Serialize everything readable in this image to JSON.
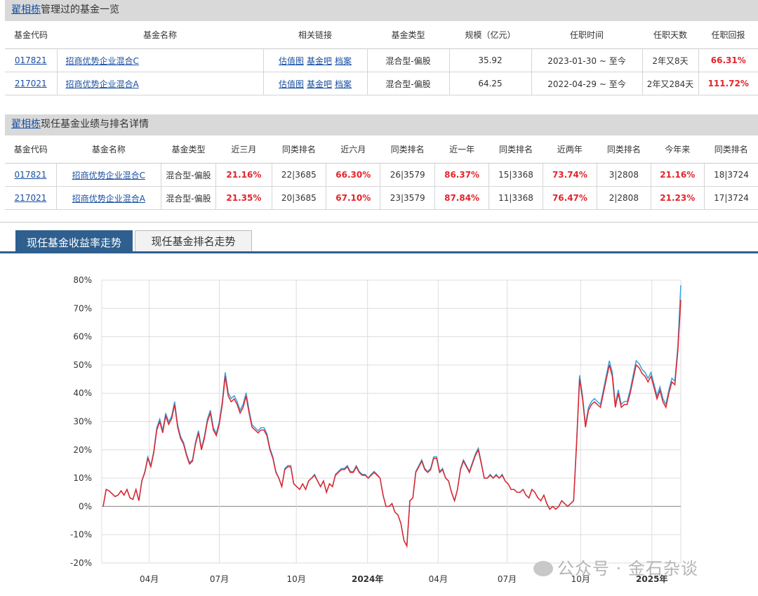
{
  "managed": {
    "manager": "翟相栋",
    "title_suffix": "管理过的基金一览",
    "headers": [
      "基金代码",
      "基金名称",
      "相关链接",
      "基金类型",
      "规模（亿元）",
      "任职时间",
      "任职天数",
      "任职回报"
    ],
    "link_labels": [
      "估值图",
      "基金吧",
      "档案"
    ],
    "rows": [
      {
        "code": "017821",
        "name": "招商优势企业混合C",
        "type": "混合型-偏股",
        "size": "35.92",
        "period": "2023-01-30 ~ 至今",
        "days": "2年又8天",
        "return": "66.31%"
      },
      {
        "code": "217021",
        "name": "招商优势企业混合A",
        "type": "混合型-偏股",
        "size": "64.25",
        "period": "2022-04-29 ~ 至今",
        "days": "2年又284天",
        "return": "111.72%"
      }
    ]
  },
  "current": {
    "manager": "翟相栋",
    "title_suffix": "现任基金业绩与排名详情",
    "headers": [
      "基金代码",
      "基金名称",
      "基金类型",
      "近三月",
      "同类排名",
      "近六月",
      "同类排名",
      "近一年",
      "同类排名",
      "近两年",
      "同类排名",
      "今年来",
      "同类排名"
    ],
    "rows": [
      {
        "code": "017821",
        "name": "招商优势企业混合C",
        "type": "混合型-偏股",
        "m3": "21.16%",
        "r3": "22|3685",
        "m6": "66.30%",
        "r6": "26|3579",
        "y1": "86.37%",
        "ry1": "15|3368",
        "y2": "73.74%",
        "ry2": "3|2808",
        "ytd": "21.16%",
        "rytd": "18|3724"
      },
      {
        "code": "217021",
        "name": "招商优势企业混合A",
        "type": "混合型-偏股",
        "m3": "21.35%",
        "r3": "20|3685",
        "m6": "67.10%",
        "r6": "23|3579",
        "y1": "87.84%",
        "ry1": "11|3368",
        "y2": "76.47%",
        "ry2": "2|2808",
        "ytd": "21.23%",
        "rytd": "17|3724"
      }
    ]
  },
  "tabs": [
    "现任基金收益率走势",
    "现任基金排名走势"
  ],
  "watermark": "公众号 · 金石杂谈",
  "chart_data": {
    "type": "line",
    "ylim": [
      -20,
      80
    ],
    "yticks": [
      "80%",
      "70%",
      "60%",
      "50%",
      "40%",
      "30%",
      "20%",
      "10%",
      "0%",
      "-10%",
      "-20%"
    ],
    "xticks": [
      {
        "label": "04月",
        "bold": false,
        "pos": 0.082
      },
      {
        "label": "07月",
        "bold": false,
        "pos": 0.203
      },
      {
        "label": "10月",
        "bold": false,
        "pos": 0.336
      },
      {
        "label": "2024年",
        "bold": true,
        "pos": 0.459
      },
      {
        "label": "04月",
        "bold": false,
        "pos": 0.581
      },
      {
        "label": "07月",
        "bold": false,
        "pos": 0.7
      },
      {
        "label": "10月",
        "bold": false,
        "pos": 0.827
      },
      {
        "label": "2025年",
        "bold": true,
        "pos": 0.95
      }
    ],
    "colors": {
      "series_a": "#e3242b",
      "series_c": "#33a3dc",
      "grid": "#dddddd",
      "zero": "#999999"
    },
    "series": [
      {
        "key": "red",
        "values": [
          0,
          6,
          5.5,
          4.5,
          3.5,
          4,
          5.5,
          4,
          6,
          3,
          2.5,
          6,
          2,
          9,
          12,
          17,
          14,
          19,
          27,
          30,
          26,
          32,
          29,
          31,
          36,
          28,
          24,
          22,
          18,
          15,
          16,
          22,
          26,
          20,
          24,
          30,
          33,
          27,
          25,
          29,
          36,
          46,
          39,
          37,
          38,
          36,
          33,
          35,
          39,
          33,
          28,
          27,
          26,
          27,
          27,
          25,
          20,
          17,
          12,
          10,
          7,
          13,
          14,
          14,
          8,
          7,
          6,
          8,
          6,
          9,
          10,
          11,
          9,
          7,
          9,
          5,
          8,
          7,
          11,
          12,
          13,
          13,
          14,
          12,
          12,
          14,
          12,
          11,
          11,
          10,
          11,
          12,
          11,
          10,
          4,
          0,
          0,
          1,
          -2,
          -3,
          -6,
          -12,
          -14,
          2,
          3,
          12,
          14,
          16,
          13,
          12,
          13,
          17,
          17,
          12,
          13,
          10,
          9,
          5,
          2,
          6,
          13,
          16,
          14,
          12,
          15,
          18,
          20,
          15,
          10,
          10,
          11,
          10,
          11,
          10,
          11,
          9,
          8,
          6,
          6,
          5,
          5,
          6,
          4,
          3,
          6,
          5,
          3,
          2,
          4,
          1,
          -1,
          0,
          -1,
          0,
          2,
          1,
          0,
          1,
          2,
          22,
          45,
          38,
          28,
          34,
          36,
          37,
          36,
          35,
          40,
          45,
          50,
          46,
          35,
          40,
          35,
          36,
          36,
          40,
          45,
          50,
          49,
          47,
          46,
          44,
          46,
          42,
          38,
          41,
          37,
          35,
          40,
          44,
          43,
          55,
          73
        ]
      },
      {
        "key": "blue",
        "values": [
          0,
          6,
          5.5,
          4.5,
          3.5,
          4,
          5.5,
          4,
          6,
          3,
          2.5,
          6,
          2,
          9,
          12,
          17,
          14,
          19,
          27,
          30,
          26,
          32,
          29,
          31,
          36,
          28,
          24,
          22,
          18,
          15,
          16,
          22,
          26,
          20,
          24,
          30,
          33,
          27,
          25,
          29,
          36,
          46,
          39,
          37,
          38,
          36,
          33,
          35,
          39,
          33,
          28,
          27,
          26,
          27,
          27,
          25,
          20,
          17,
          12,
          10,
          7,
          13,
          14,
          14,
          8,
          7,
          6,
          8,
          6,
          9,
          10,
          11,
          9,
          7,
          9,
          5,
          8,
          7,
          11,
          12,
          13,
          13,
          14,
          12,
          12,
          14,
          12,
          11,
          11,
          10,
          11,
          12,
          11,
          10,
          4,
          0,
          0,
          1,
          -2,
          -3,
          -6,
          -12,
          -14,
          2,
          3,
          12,
          14,
          16,
          13,
          12,
          13,
          17,
          17,
          12,
          13,
          10,
          9,
          5,
          2,
          6,
          13,
          16,
          14,
          12,
          15,
          18,
          20,
          15,
          10,
          10,
          11,
          10,
          11,
          10,
          11,
          9,
          8,
          6,
          6,
          5,
          5,
          6,
          4,
          3,
          6,
          5,
          3,
          2,
          4,
          1,
          -1,
          0,
          -1,
          0,
          2,
          1,
          0,
          1,
          2,
          22,
          45,
          38,
          28,
          34,
          36,
          37,
          36,
          35,
          40,
          45,
          50,
          46,
          35,
          40,
          35,
          36,
          36,
          40,
          45,
          50,
          49,
          47,
          46,
          44,
          46,
          42,
          38,
          41,
          37,
          35,
          40,
          44,
          43,
          55,
          73
        ]
      }
    ]
  }
}
